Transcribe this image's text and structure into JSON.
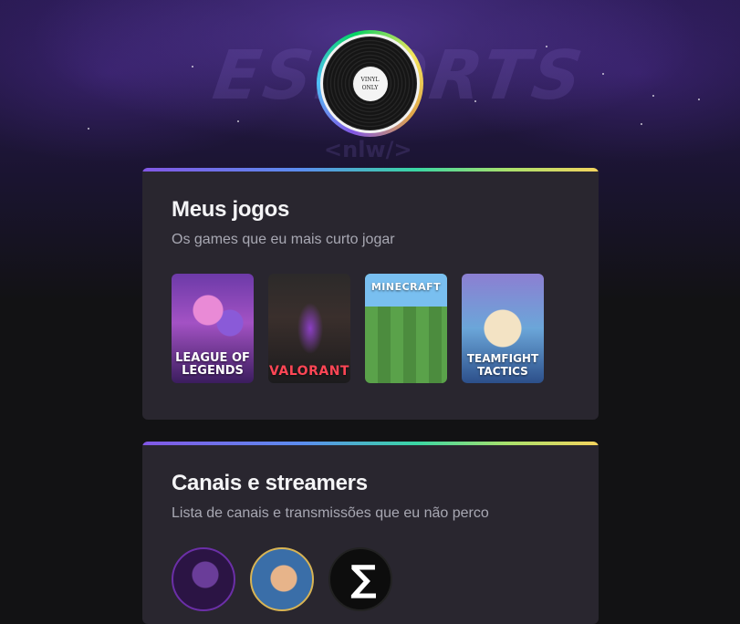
{
  "profile": {
    "avatar_label_line1": "VINYL",
    "avatar_label_line2": "ONLY",
    "ring_colors": [
      "#8257e5",
      "#4fc3f7",
      "#04d361",
      "#f4e65c"
    ]
  },
  "background": {
    "watermark": "ESPORTS",
    "watermark_sub": "<nlw/>"
  },
  "games_section": {
    "title": "Meus jogos",
    "subtitle": "Os games que eu mais curto jogar",
    "games": [
      {
        "name": "LEAGUE OF LEGENDS"
      },
      {
        "name": "VALORANT"
      },
      {
        "name": "MINECRAFT"
      },
      {
        "name": "TEAMFIGHT TACTICS"
      }
    ]
  },
  "streamers_section": {
    "title": "Canais e streamers",
    "subtitle": "Lista de canais e transmissões que eu não perco",
    "channels": [
      {
        "icon": "streamer-avatar"
      },
      {
        "icon": "streamer-avatar"
      },
      {
        "icon": "channel-logo"
      }
    ]
  },
  "colors": {
    "background": "#121214",
    "card": "#29262f",
    "title": "#f4f4f6",
    "subtitle": "#a8a8b3",
    "accent_gradient": [
      "#8257e5",
      "#5b8def",
      "#3ad6a4",
      "#f4d35e"
    ]
  }
}
